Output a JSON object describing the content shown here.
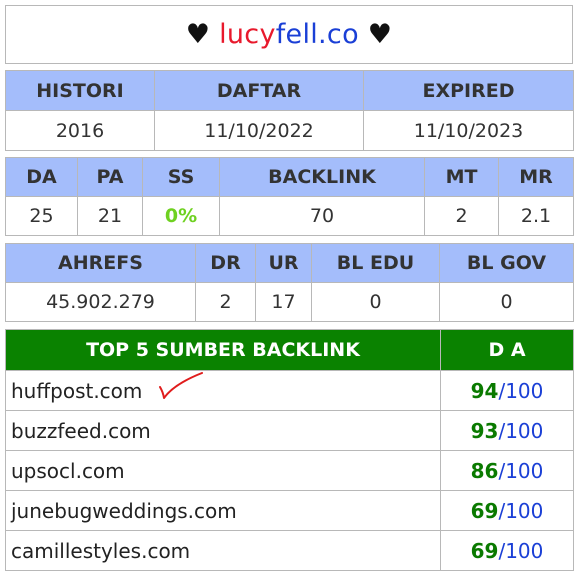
{
  "title": {
    "heart_left": "♥",
    "part1": "lucy",
    "part2": "fell.co",
    "heart_right": "♥"
  },
  "info": {
    "headers": [
      "HISTORI",
      "DAFTAR",
      "EXPIRED"
    ],
    "values": [
      "2016",
      "11/10/2022",
      "11/10/2023"
    ]
  },
  "metrics": {
    "headers": [
      "DA",
      "PA",
      "SS",
      "BACKLINK",
      "MT",
      "MR"
    ],
    "values": [
      "25",
      "21",
      "0%",
      "70",
      "2",
      "2.1"
    ]
  },
  "ahrefs": {
    "headers": [
      "AHREFS",
      "DR",
      "UR",
      "BL EDU",
      "BL GOV"
    ],
    "values": [
      "45.902.279",
      "2",
      "17",
      "0",
      "0"
    ]
  },
  "backlinks": {
    "header_source": "TOP 5 SUMBER BACKLINK",
    "header_da": "D A",
    "separator": "/",
    "max": "100",
    "rows": [
      {
        "domain": "huffpost.com",
        "da": "94"
      },
      {
        "domain": "buzzfeed.com",
        "da": "93"
      },
      {
        "domain": "upsocl.com",
        "da": "86"
      },
      {
        "domain": "junebugweddings.com",
        "da": "69"
      },
      {
        "domain": "camillestyles.com",
        "da": "69"
      }
    ]
  },
  "colors": {
    "header_blue": "#a4bdfb",
    "header_green": "#0a8200",
    "brand_red": "#e8192c",
    "brand_blue": "#1a3fd6",
    "ss_green": "#6fd121",
    "check_red": "#e01c1c"
  },
  "icons": {
    "check": "red-checkmark-icon"
  }
}
